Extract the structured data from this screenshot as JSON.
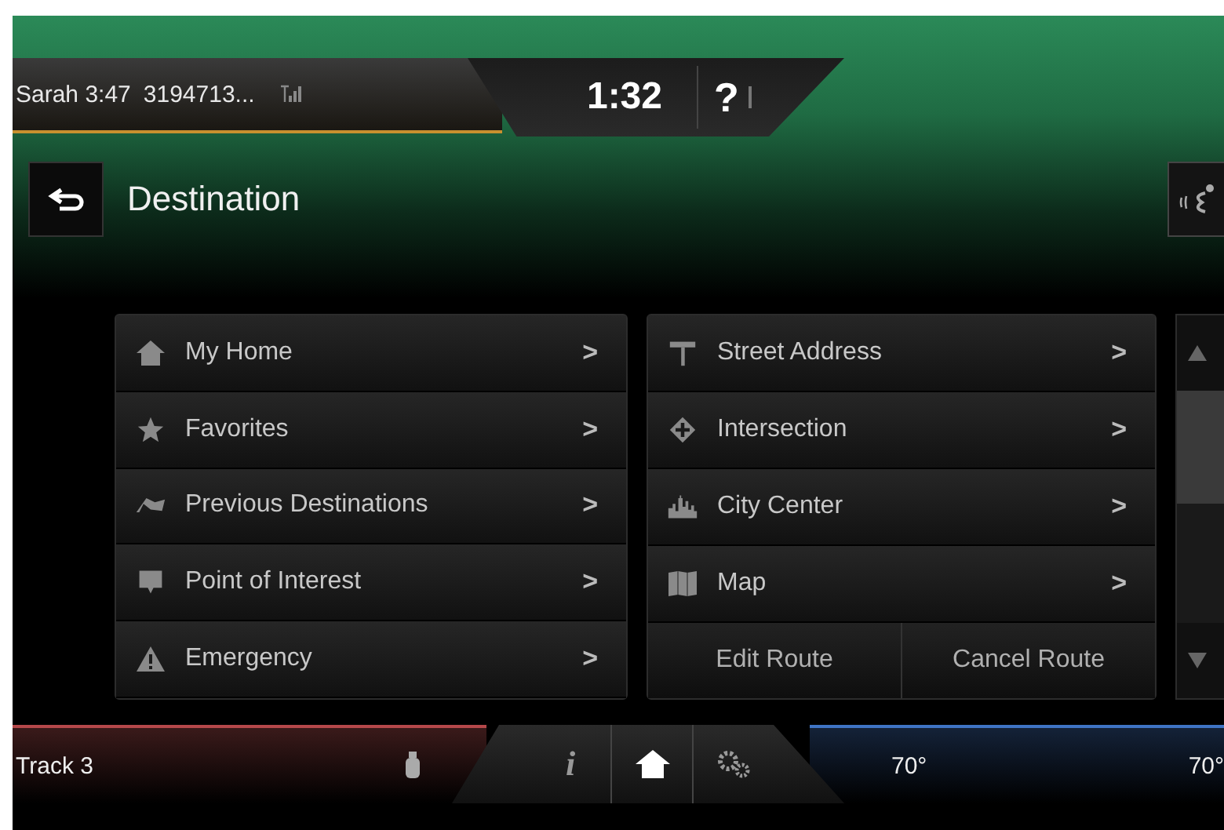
{
  "status_bar": {
    "caller": "Sarah 3:47",
    "number": "3194713...",
    "clock": "1:32",
    "help": "?"
  },
  "header": {
    "title": "Destination"
  },
  "left_menu": [
    {
      "label": "My Home",
      "arrow": ">"
    },
    {
      "label": "Favorites",
      "arrow": ">"
    },
    {
      "label": "Previous Destinations",
      "arrow": ">"
    },
    {
      "label": "Point of Interest",
      "arrow": ">"
    },
    {
      "label": "Emergency",
      "arrow": ">"
    }
  ],
  "right_menu": [
    {
      "label": "Street Address",
      "arrow": ">"
    },
    {
      "label": "Intersection",
      "arrow": ">"
    },
    {
      "label": "City Center",
      "arrow": ">"
    },
    {
      "label": "Map",
      "arrow": ">"
    }
  ],
  "route_buttons": [
    "Edit Route",
    "Cancel Route"
  ],
  "bottom_bar": {
    "source": "Track 3",
    "driver_temp": "70°",
    "passenger_temp": "70°",
    "info": "i"
  }
}
